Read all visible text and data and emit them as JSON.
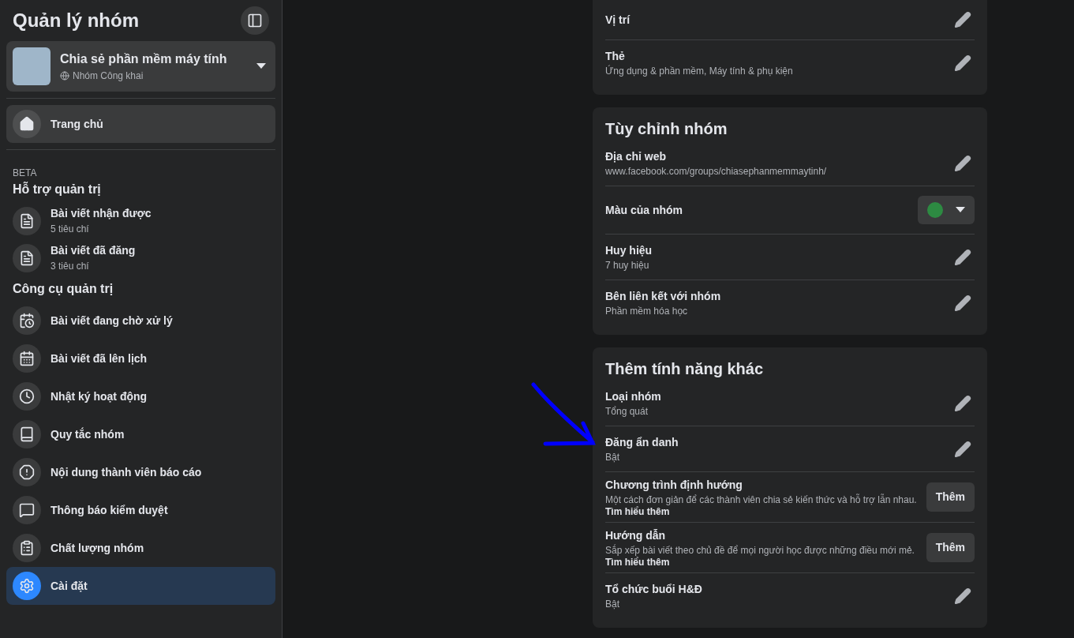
{
  "sidebar": {
    "title": "Quản lý nhóm",
    "group": {
      "name": "Chia sẻ phần mềm máy tính",
      "privacy": "Nhóm Công khai"
    },
    "home": {
      "label": "Trang chủ",
      "selected": false
    },
    "sections": [
      {
        "tag": "BETA",
        "title": "Hỗ trợ quản trị",
        "items": [
          {
            "label": "Bài viết nhận được",
            "subtitle": "5 tiêu chí",
            "selected": false
          },
          {
            "label": "Bài viết đã đăng",
            "subtitle": "3 tiêu chí",
            "selected": false
          }
        ]
      },
      {
        "title": "Công cụ quản trị",
        "items": [
          {
            "label": "Bài viết đang chờ xử lý",
            "selected": false
          },
          {
            "label": "Bài viết đã lên lịch",
            "selected": false
          },
          {
            "label": "Nhật ký hoạt động",
            "selected": false
          },
          {
            "label": "Quy tắc nhóm",
            "selected": false
          },
          {
            "label": "Nội dung thành viên báo cáo",
            "selected": false
          },
          {
            "label": "Thông báo kiểm duyệt",
            "selected": false
          },
          {
            "label": "Chất lượng nhóm",
            "selected": false
          },
          {
            "label": "Cài đặt",
            "selected": true
          }
        ]
      }
    ]
  },
  "cards": [
    {
      "rows": [
        {
          "kind": "edit",
          "label": "Vị trí"
        },
        {
          "kind": "edit",
          "label": "Thẻ",
          "value": "Ứng dụng & phần mềm, Máy tính & phụ kiện"
        }
      ]
    },
    {
      "title": "Tùy chỉnh nhóm",
      "rows": [
        {
          "kind": "edit",
          "label": "Địa chỉ web",
          "value": "www.facebook.com/groups/chiasephanmemmaytinh/"
        },
        {
          "kind": "color",
          "label": "Màu của nhóm",
          "color": "#2d8a42"
        },
        {
          "kind": "edit",
          "label": "Huy hiệu",
          "value": "7 huy hiệu"
        },
        {
          "kind": "edit",
          "label": "Bên liên kết với nhóm",
          "value": "Phần mềm hóa học"
        }
      ]
    },
    {
      "title": "Thêm tính năng khác",
      "rows": [
        {
          "kind": "edit",
          "label": "Loại nhóm",
          "value": "Tổng quát"
        },
        {
          "kind": "edit",
          "label": "Đăng ẩn danh",
          "value": "Bật"
        },
        {
          "kind": "add",
          "label": "Chương trình định hướng",
          "value": "Một cách đơn giản để các thành viên chia sẻ kiến thức và hỗ trợ lẫn nhau.",
          "link": "Tìm hiểu thêm",
          "button": "Thêm"
        },
        {
          "kind": "add",
          "label": "Hướng dẫn",
          "value": "Sắp xếp bài viết theo chủ đề để mọi người học được những điều mới mẻ.",
          "link": "Tìm hiểu thêm",
          "button": "Thêm"
        },
        {
          "kind": "edit",
          "label": "Tổ chức buổi H&Đ",
          "value": "Bật"
        }
      ]
    }
  ]
}
